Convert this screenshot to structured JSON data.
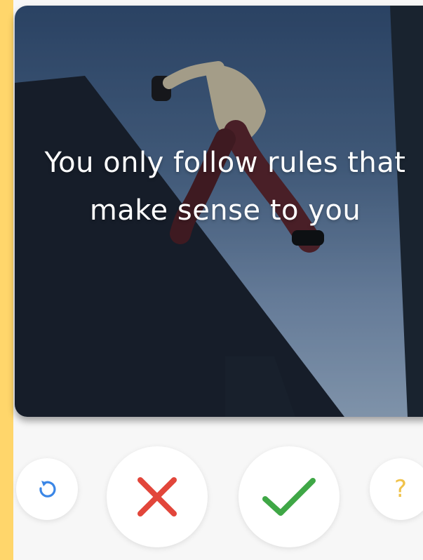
{
  "card": {
    "quote": "You only follow rules that make sense to you"
  },
  "actions": {
    "undo_icon": "undo-icon",
    "dislike_icon": "x-icon",
    "like_icon": "check-icon",
    "help_label": "?"
  },
  "colors": {
    "accent_strip": "#ffd66b",
    "dislike": "#e2463b",
    "like": "#3fa746",
    "undo": "#3a86e6",
    "help": "#f0c24a"
  }
}
